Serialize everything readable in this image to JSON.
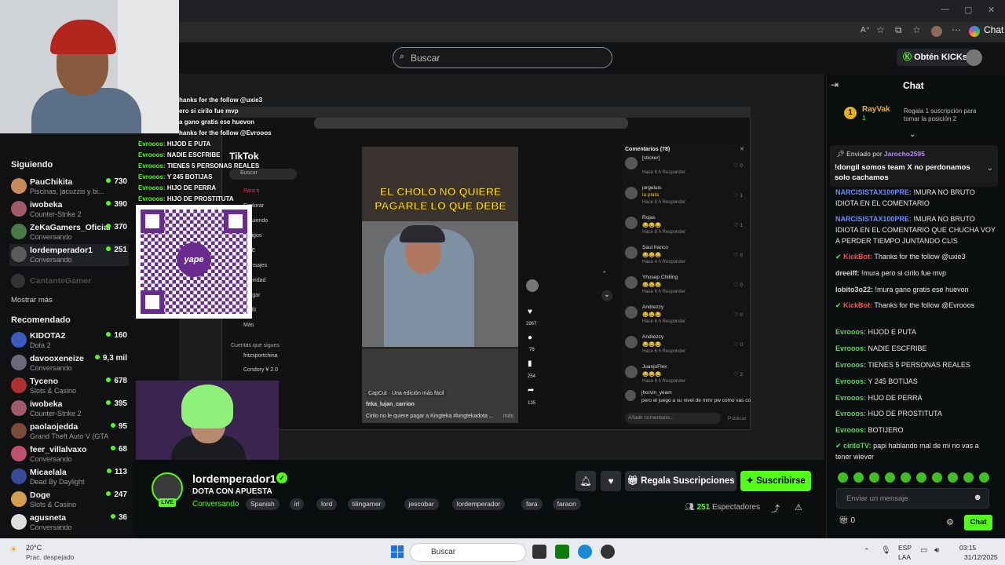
{
  "browser": {
    "minimize": "—",
    "maximize": "▢",
    "close": "✕",
    "read_aloud": "A⁺",
    "chat_label": "Chat"
  },
  "header": {
    "search_placeholder": "Buscar",
    "get_kicks": "Obtén KICKs"
  },
  "sidebar": {
    "following_heading": "Siguiendo",
    "following": [
      {
        "name": "PauChikita",
        "category": "Piscinas, jacuzzis y bi...",
        "viewers": "730",
        "color": "#c98a5a"
      },
      {
        "name": "iwobeka",
        "category": "Counter-Strike 2",
        "viewers": "390",
        "color": "#a05a6a"
      },
      {
        "name": "ZeKaGamers_Oficial",
        "category": "Conversando",
        "viewers": "370",
        "color": "#4a7a4a"
      },
      {
        "name": "lordemperador1",
        "category": "Conversando",
        "viewers": "251",
        "color": "#5a5a5a"
      }
    ],
    "offline": "CantanteGamer",
    "show_more": "Mostrar más",
    "recommended_heading": "Recomendado",
    "recommended": [
      {
        "name": "KIDOTA2",
        "category": "Dota 2",
        "viewers": "160",
        "color": "#3b5bbf"
      },
      {
        "name": "davooxeneize",
        "category": "Conversando",
        "viewers": "9,3 mil",
        "color": "#6a6a7a"
      },
      {
        "name": "Tyceno",
        "category": "Slots & Casino",
        "viewers": "678",
        "color": "#b03030"
      },
      {
        "name": "iwobeka",
        "category": "Counter-Strike 2",
        "viewers": "395",
        "color": "#a05a6a"
      },
      {
        "name": "paolaojedda",
        "category": "Grand Theft Auto V (GTA)",
        "viewers": "95",
        "color": "#7a4a3a"
      },
      {
        "name": "feer_villalvaxo",
        "category": "Conversando",
        "viewers": "68",
        "color": "#c05070"
      },
      {
        "name": "Micaelala",
        "category": "Dead By Daylight",
        "viewers": "113",
        "color": "#3a4a9a"
      },
      {
        "name": "Doge",
        "category": "Slots & Casino",
        "viewers": "247",
        "color": "#d0a050"
      },
      {
        "name": "agusneta",
        "category": "Conversando",
        "viewers": "36",
        "color": "#ddd"
      }
    ]
  },
  "stream": {
    "overlay_chat": [
      "hanks for the follow @uxie3",
      "ero si cirilo fue mvp",
      "a gano gratis ese huevon",
      "hanks for the follow @Evrooos",
      "HIJOD E PUTA",
      "NADIE ESCFRIBE",
      "TIENES 5 PERSONAS REALES",
      "Y 245 BOTIJAS",
      "HIJO DE PERRA",
      "HIJO DE PROSTITUTA"
    ],
    "overlay_user": "Evrooos:",
    "qr_text": "yape",
    "tiktok": {
      "logo": "TikTok",
      "search": "Buscar",
      "menu": [
        "Para ti",
        "Explorar",
        "Siguiendo",
        "Amigos",
        "LIVE",
        "Mensajes",
        "Actividad",
        "Cargar",
        "Perfil",
        "Más"
      ],
      "following_accounts_heading": "Cuentas que sigues",
      "accounts": [
        "fritzsportchina",
        "Condory ¥ 2.0"
      ],
      "video_caption": "EL CHOLO NO QUIERE PAGARLE LO QUE DEBE",
      "video_app_badge": "CapCut · Una edición más fácil",
      "video_author": "feka_lujan_carrion",
      "video_desc": "Cirilo no le quiere pagar a Kingteka #kingtekadota ...",
      "video_more": "más",
      "likes": "2967",
      "comments_count": "78",
      "saves": "254",
      "shares": "135",
      "comments_heading": "Comentarios (78)",
      "comments": [
        {
          "name": "[sticker]",
          "text": "",
          "meta": "Hace 6 h   Responder",
          "likes": "0"
        },
        {
          "name": "jorgeluis",
          "text": "la plata",
          "meta": "Hace 8 h   Responder",
          "likes": "1"
        },
        {
          "name": "Rojas",
          "text": "😂😂😂",
          "meta": "Hace 8 h   Responder",
          "likes": "1"
        },
        {
          "name": "Saul franco",
          "text": "😂😂😂",
          "meta": "Hace 4 h   Responder",
          "likes": "0"
        },
        {
          "name": "Yhosep Chilling",
          "text": "😂😂😂",
          "meta": "Hace 6 h   Responder",
          "likes": "0"
        },
        {
          "name": "Andrezzy",
          "text": "😂😂😂",
          "meta": "Hace 6 h   Responder",
          "likes": "0"
        },
        {
          "name": "Andrezzy",
          "text": "😂😂😂",
          "meta": "Hace 6 h   Responder",
          "likes": "0"
        },
        {
          "name": "JuanjoFlex",
          "text": "😂😂😂",
          "meta": "Hace 6 h   Responder",
          "likes": "2"
        }
      ],
      "last_comment": "jhorvin_yeam",
      "last_comment_text": "pero el juego a su nivel de mmr pw como vas co",
      "comment_placeholder": "Añadir comentario...",
      "publish": "Publicar"
    }
  },
  "channel": {
    "name": "lordemperador1",
    "title": "DOTA CON APUESTA",
    "category": "Conversando",
    "live_badge": "LIVE",
    "tags": [
      "Spanish",
      "irl",
      "lord",
      "tilingamer",
      "jescobar",
      "lordemperador",
      "fara",
      "faraon"
    ],
    "gift_button": "Regala Suscripciones",
    "subscribe_button": "Suscribirse",
    "viewers": "251",
    "viewers_label": "Espectadores"
  },
  "chat": {
    "title": "Chat",
    "leader_name": "RayVak",
    "leader_count": "1",
    "leader_promo": "Regala 1 suscripción para tomar la posición 2",
    "pinned_by_label": "Enviado por",
    "pinned_by": "Jarocho2595",
    "pinned_text": "!dongil somos team X no perdonamos solo cachamos",
    "messages": [
      {
        "user": "NARCISISTAX100PRE:",
        "text": " !MURA NO BRUTO IDIOTA EN EL COMENTARIO",
        "color": "#6b8cff"
      },
      {
        "user": "NARCISISTAX100PRE:",
        "text": " !MURA NO BRUTO IDIOTA EN EL COMENTARIO QUE CHUCHA VOY A PERDER TIEMPO JUNTANDO CLIS",
        "color": "#6b8cff"
      },
      {
        "user": "KickBot:",
        "text": " Thanks for the follow @uxie3",
        "color": "#ff4d4d"
      },
      {
        "user": "dreeiff:",
        "text": " !mura pero si cirilo fue mvp",
        "color": "#d7d7d7"
      },
      {
        "user": "lobito3o22:",
        "text": " !mura gano gratis ese huevon",
        "color": "#d7d7d7"
      },
      {
        "user": "KickBot:",
        "text": " Thanks for the follow @Evrooos",
        "color": "#ff4d4d"
      },
      {
        "user": "Evrooos:",
        "text": " HIJOD E PUTA",
        "color": "#5fd35f"
      },
      {
        "user": "Evrooos:",
        "text": " NADIE ESCFRIBE",
        "color": "#5fd35f"
      },
      {
        "user": "Evrooos:",
        "text": " TIENES 5 PERSONAS REALES",
        "color": "#5fd35f"
      },
      {
        "user": "Evrooos:",
        "text": " Y 245 BOTIJAS",
        "color": "#5fd35f"
      },
      {
        "user": "Evrooos:",
        "text": " HIJO DE PERRA",
        "color": "#5fd35f"
      },
      {
        "user": "Evrooos:",
        "text": " HIJO DE PROSTITUTA",
        "color": "#5fd35f"
      },
      {
        "user": "Evrooos:",
        "text": " BOTIJERO",
        "color": "#5fd35f"
      },
      {
        "user": "ciriloTV:",
        "text": " papi hablando mal de mi no vas a tener wiever",
        "color": "#5fd35f"
      }
    ],
    "input_placeholder": "Enviar un mensaje",
    "kicks_balance": "0",
    "send_button": "Chat"
  },
  "taskbar": {
    "temperature": "20°C",
    "weather": "Prac. despejado",
    "search": "Buscar",
    "lang1": "ESP",
    "lang2": "LAA",
    "time": "03:15",
    "date": "31/12/2025"
  },
  "colors": {
    "kick_green": "#53fc18",
    "background": "#0b0e0f"
  }
}
